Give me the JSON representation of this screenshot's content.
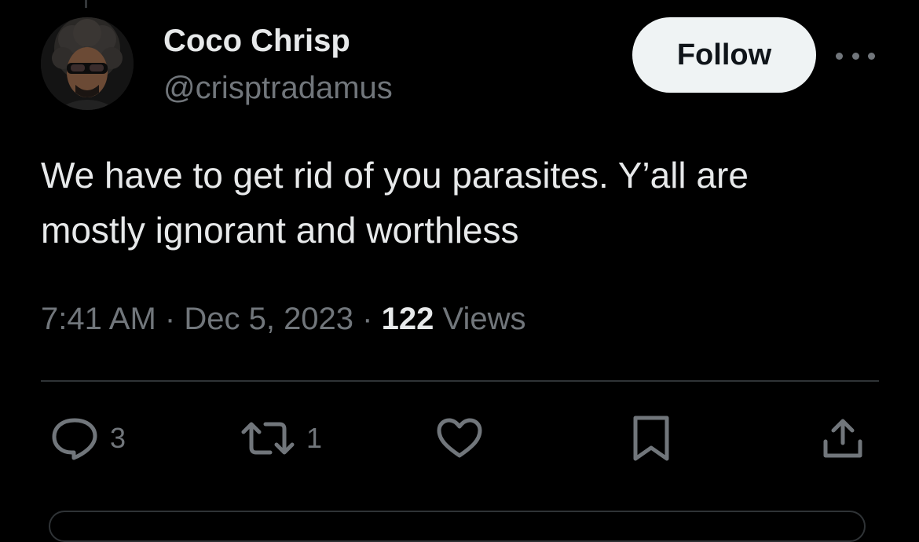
{
  "tweet": {
    "author_name": "Coco Chrisp",
    "author_handle": "@crisptradamus",
    "follow_label": "Follow",
    "text": "We have to get rid of you parasites. Y’all are\nmostly ignorant and worthless",
    "time": "7:41 AM",
    "separator": "·",
    "date": "Dec 5, 2023",
    "views_count": "122",
    "views_label": "Views"
  },
  "actions": {
    "replies": "3",
    "reposts": "1"
  },
  "icons": {
    "more": "more-horizontal-icon",
    "reply": "reply-icon",
    "repost": "repost-icon",
    "like": "heart-icon",
    "bookmark": "bookmark-icon",
    "share": "share-icon"
  },
  "colors": {
    "background": "#000000",
    "text_primary": "#e7e9ea",
    "text_secondary": "#71767b",
    "button_bg": "#eff3f4",
    "divider": "#2f3336"
  }
}
